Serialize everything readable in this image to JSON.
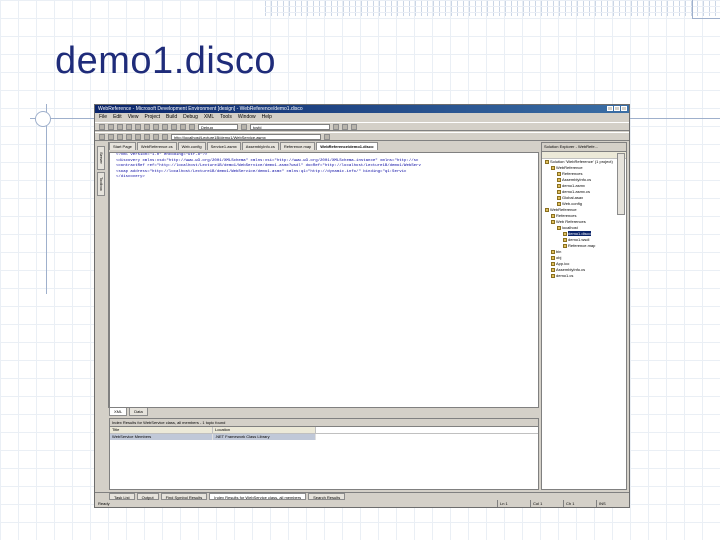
{
  "slide": {
    "title": "demo1.disco"
  },
  "window": {
    "title": "WebReference - Microsoft Development Environment [design] - WebReference/demo1.disco"
  },
  "menu": [
    "File",
    "Edit",
    "View",
    "Project",
    "Build",
    "Debug",
    "XML",
    "Tools",
    "Window",
    "Help"
  ],
  "toolbar": {
    "config_select": "Debug",
    "find_select": "tcsfd",
    "url_select": "http://localhost/Lecture1B/demo1/WebService.asmx"
  },
  "left_strip": {
    "tab1": "Server",
    "tab2": "Toolbox"
  },
  "doc_tabs": [
    {
      "label": "Start Page"
    },
    {
      "label": "WebReference.cs"
    },
    {
      "label": "Web.config"
    },
    {
      "label": "Service1.asmx"
    },
    {
      "label": "AssemblyInfo.cs"
    },
    {
      "label": "Reference.map"
    },
    {
      "label": "WebReference/demo1.disco",
      "active": true
    }
  ],
  "editor_lines": [
    "<?xml version=\"1.0\" encoding=\"utf-8\"?>",
    "<discovery xmlns:xsd=\"http://www.w3.org/2001/XMLSchema\" xmlns:xsi=\"http://www.w3.org/2001/XMLSchema-instance\" xmlns=\"http://sc",
    "  <contractRef ref=\"http://localhost/Lecture1B/demo1/WebService/demo1.asmx?wsdl\" docRef=\"http://localhost/Lecture1B/demo1/WebServ",
    "  <soap address=\"http://localhost/Lecture1B/demo1/WebService/demo1.asmx\" xmlns:q1=\"http://dynamic.info/\" binding=\"q1:Servic",
    "</discovery>"
  ],
  "editor_tabs": {
    "xml": "XML",
    "data": "Data"
  },
  "find_panel": {
    "header": "Index Results for WebService class, all members - 1 topic found",
    "columns": [
      "Title",
      "Location"
    ],
    "rows": [
      [
        "WebService Members",
        ".NET Framework Class Library"
      ]
    ]
  },
  "right_panel": {
    "header": "Solution Explorer - WebRefe...",
    "tree": [
      {
        "label": "Solution 'WebReference' (1 project)",
        "indent": 0
      },
      {
        "label": "WebReference",
        "indent": 1
      },
      {
        "label": "References",
        "indent": 2
      },
      {
        "label": "AssemblyInfo.cs",
        "indent": 2
      },
      {
        "label": "demo1.asmx",
        "indent": 2
      },
      {
        "label": "demo1.asmx.cs",
        "indent": 2
      },
      {
        "label": "Global.asax",
        "indent": 2
      },
      {
        "label": "Web.config",
        "indent": 2
      },
      {
        "label": "WebReference",
        "indent": 0
      },
      {
        "label": "References",
        "indent": 1
      },
      {
        "label": "Web References",
        "indent": 1
      },
      {
        "label": "localhost",
        "indent": 2
      },
      {
        "label": "demo1.disco",
        "indent": 3,
        "selected": true
      },
      {
        "label": "demo1.wsdl",
        "indent": 3
      },
      {
        "label": "Reference.map",
        "indent": 3
      },
      {
        "label": "bin",
        "indent": 1
      },
      {
        "label": "obj",
        "indent": 1
      },
      {
        "label": "App.ico",
        "indent": 1
      },
      {
        "label": "AssemblyInfo.cs",
        "indent": 1
      },
      {
        "label": "demo1.cs",
        "indent": 1
      }
    ]
  },
  "bottom_tabs": [
    {
      "label": "Task List"
    },
    {
      "label": "Output"
    },
    {
      "label": "Find Symbol Results"
    },
    {
      "label": "Index Results for WebService class, all members",
      "active": true
    },
    {
      "label": "Search Results"
    }
  ],
  "status": {
    "left": "Ready",
    "ln": "Ln 1",
    "col": "Col 1",
    "ch": "Ch 1",
    "mode": "INS"
  }
}
